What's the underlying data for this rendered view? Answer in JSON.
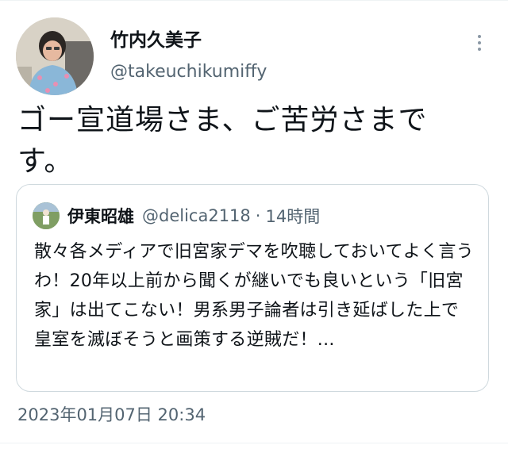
{
  "tweet": {
    "author": {
      "display_name": "竹内久美子",
      "handle": "@takeuchikumiffy"
    },
    "text": "ゴー宣道場さま、ご苦労さまです。",
    "more_icon": "more-vertical-icon"
  },
  "quoted_tweet": {
    "author": {
      "display_name": "伊東昭雄",
      "handle": "@delica2118"
    },
    "separator": "·",
    "time": "14時間",
    "text": "散々各メディアで旧宮家デマを吹聴しておいてよく言うわ！20年以上前から聞くが継いでも良いという「旧宮家」は出てこない！男系男子論者は引き延ばした上で皇室を滅ぼそうと画策する逆賊だ！..."
  },
  "timestamp": "2023年01月07日 20:34"
}
